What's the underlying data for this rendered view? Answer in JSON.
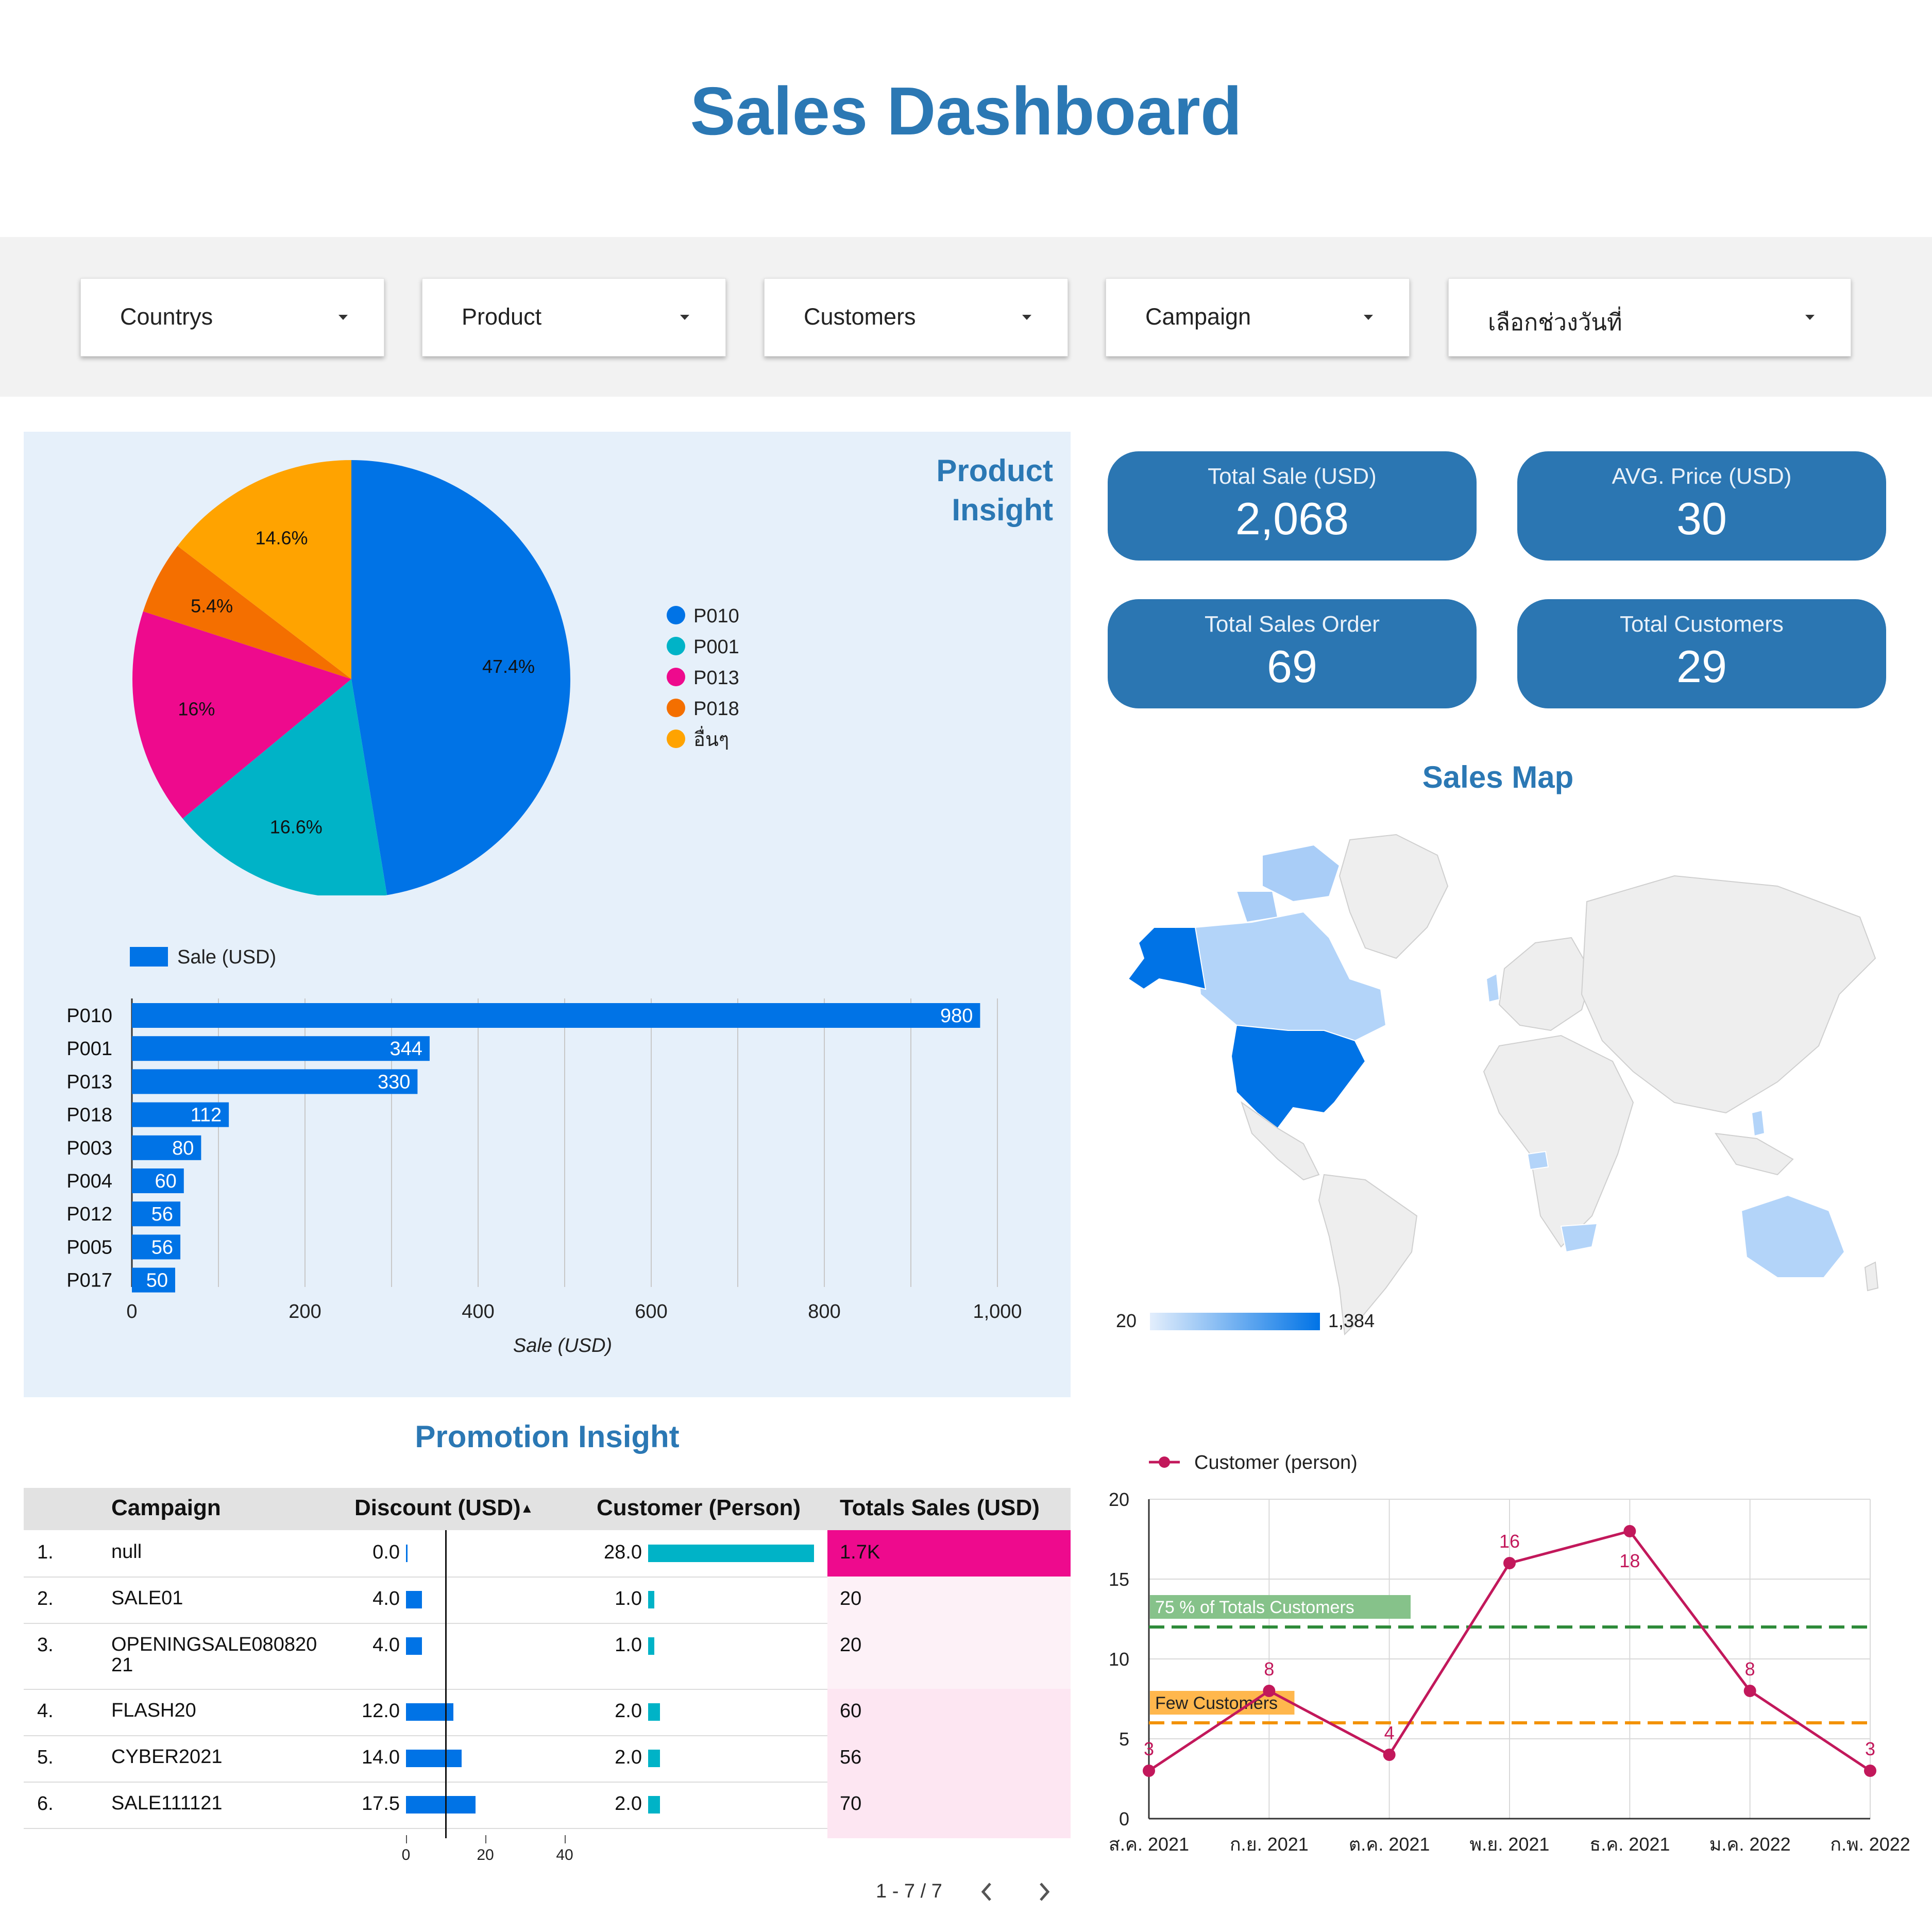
{
  "page": {
    "title": "Sales Dashboard"
  },
  "filters": [
    {
      "label": "Countrys"
    },
    {
      "label": "Product"
    },
    {
      "label": "Customers"
    },
    {
      "label": "Campaign"
    },
    {
      "label": "เลือกช่วงวันที่"
    }
  ],
  "product_insight": {
    "title_line1": "Product",
    "title_line2": "Insight"
  },
  "kpis": [
    {
      "label": "Total Sale (USD)",
      "value": "2,068"
    },
    {
      "label": "AVG. Price (USD)",
      "value": "30"
    },
    {
      "label": "Total Sales Order",
      "value": "69"
    },
    {
      "label": "Total Customers",
      "value": "29"
    }
  ],
  "sales_map": {
    "title": "Sales Map",
    "legend_min": "20",
    "legend_max": "1,384"
  },
  "promotion": {
    "title": "Promotion Insight",
    "headers": [
      "Campaign",
      "Discount (USD)",
      "Customer (Person)",
      "Totals Sales (USD)"
    ],
    "sort_indicator": "▲",
    "rows": [
      {
        "idx": "1.",
        "campaign": "null",
        "discount": "0.0",
        "customer": "28.0",
        "sales": "1.7K"
      },
      {
        "idx": "2.",
        "campaign": "SALE01",
        "discount": "4.0",
        "customer": "1.0",
        "sales": "20"
      },
      {
        "idx": "3.",
        "campaign": "OPENINGSALE08082021",
        "discount": "4.0",
        "customer": "1.0",
        "sales": "20"
      },
      {
        "idx": "4.",
        "campaign": "FLASH20",
        "discount": "12.0",
        "customer": "2.0",
        "sales": "60"
      },
      {
        "idx": "5.",
        "campaign": "CYBER2021",
        "discount": "14.0",
        "customer": "2.0",
        "sales": "56"
      },
      {
        "idx": "6.",
        "campaign": "SALE111121",
        "discount": "17.5",
        "customer": "2.0",
        "sales": "70"
      }
    ],
    "axis_ticks": [
      "0",
      "20",
      "40"
    ],
    "pager_text": "1 - 7 / 7",
    "prev_icon": "chevron-left-icon",
    "next_icon": "chevron-right-icon"
  },
  "colors": {
    "title": "#2b78b4",
    "kpi_bg": "#2b76b2",
    "bar": "#0073e6",
    "cyan": "#00b3c7",
    "magenta": "#ee0a8d",
    "orange": "#f46f00",
    "amber": "#ffa300",
    "line": "#c2185b"
  },
  "chart_data": [
    {
      "type": "pie",
      "categories": [
        "P010",
        "P001",
        "P013",
        "P018",
        "อื่นๆ"
      ],
      "values": [
        47.4,
        16.6,
        16,
        5.4,
        14.6
      ],
      "labels": [
        "47.4%",
        "16.6%",
        "16%",
        "5.4%",
        "14.6%"
      ],
      "colors": [
        "#0073e6",
        "#00b3c7",
        "#ee0a8d",
        "#f46f00",
        "#ffa300"
      ],
      "legend_position": "right"
    },
    {
      "type": "bar",
      "orientation": "horizontal",
      "categories": [
        "P010",
        "P001",
        "P013",
        "P018",
        "P003",
        "P004",
        "P012",
        "P005",
        "P017"
      ],
      "series": [
        {
          "name": "Sale (USD)",
          "values": [
            980,
            344,
            330,
            112,
            80,
            60,
            56,
            56,
            50
          ]
        }
      ],
      "xlabel": "Sale (USD)",
      "xlim": [
        0,
        1000
      ],
      "x_ticks": [
        "0",
        "200",
        "400",
        "600",
        "800",
        "1,000"
      ],
      "legend_position": "top-left",
      "grid": true
    },
    {
      "type": "line",
      "x": [
        "ส.ค. 2021",
        "ก.ย. 2021",
        "ต.ค. 2021",
        "พ.ย. 2021",
        "ธ.ค. 2021",
        "ม.ค. 2022",
        "ก.พ. 2022"
      ],
      "series": [
        {
          "name": "Customer (person)",
          "values": [
            3,
            8,
            4,
            16,
            18,
            8,
            3
          ]
        }
      ],
      "ylim": [
        0,
        20
      ],
      "y_ticks": [
        "0",
        "5",
        "10",
        "15",
        "20"
      ],
      "reference_lines": [
        {
          "label": "75 % of Totals Customers",
          "value": 12,
          "color": "#2e8b3a"
        },
        {
          "label": "Few Customers",
          "value": 6,
          "color": "#f39200"
        }
      ],
      "legend_position": "top-left",
      "grid": true
    }
  ]
}
